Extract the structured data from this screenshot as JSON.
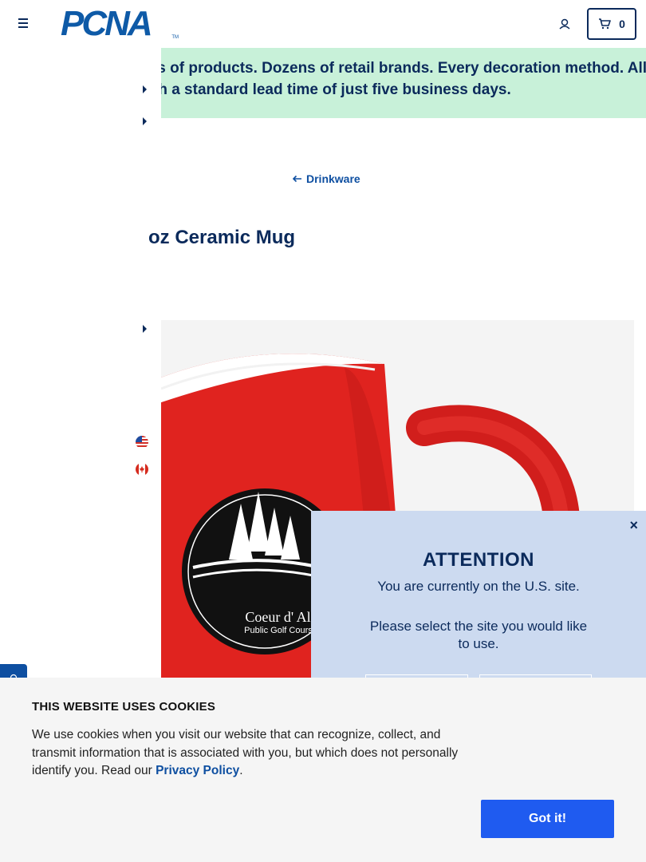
{
  "header": {
    "logo_text": "PCNA",
    "logo_tm": "TM",
    "cart_count": "0"
  },
  "banner": {
    "line1": "ls of products. Dozens of retail brands. Every decoration method. All",
    "line2": "th a standard lead time of just five business days."
  },
  "breadcrumb": {
    "back_label": "Drinkware"
  },
  "product": {
    "title": "oz Ceramic Mug",
    "imprint_line1": "Coeur d' Alen",
    "imprint_line2": "Public Golf Course",
    "mug_color": "#e0231f"
  },
  "modal": {
    "close": "×",
    "title": "ATTENTION",
    "line1": "You are currently on the U.S. site.",
    "line2": "Please select the site you would like to use."
  },
  "cookie": {
    "title": "THIS WEBSITE USES COOKIES",
    "body": "We use cookies when you visit our website that can recognize, collect, and transmit information that is associated with you, but which does not personally identify you. Read our ",
    "link": "Privacy Policy",
    "period": ".",
    "accept": "Got it!"
  },
  "colors": {
    "navy": "#0b2a5b",
    "brand_blue": "#0e5aa7",
    "banner_green": "#c8f1d9",
    "modal_blue": "#ccdaf0",
    "accept_blue": "#1f5bf0"
  }
}
